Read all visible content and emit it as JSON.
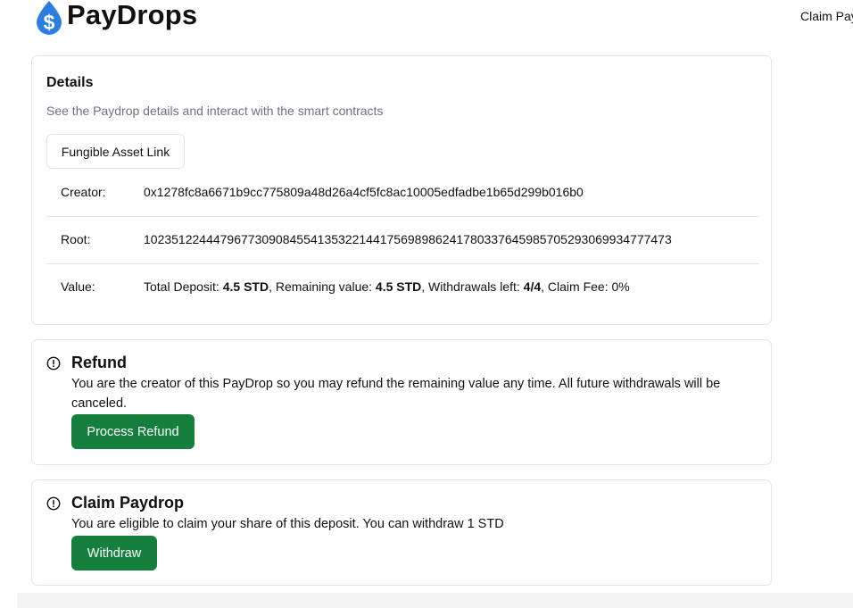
{
  "header": {
    "brand": "PayDrops",
    "logo_icon": "dollar-drop-icon",
    "nav_link": "Claim Pay"
  },
  "details": {
    "title": "Details",
    "description": "See the Paydrop details and interact with the smart contracts",
    "asset_button": "Fungible Asset Link",
    "creator_label": "Creator:",
    "creator_value": "0x1278fc8a6671b9cc775809a48d26a4cf5fc8ac10005edfadbe1b65d299b016b0",
    "root_label": "Root:",
    "root_value": "10235122444796773090845541353221441756989862417803376459857052930699347​77473",
    "value_label": "Value:",
    "value": {
      "total_label": "Total Deposit: ",
      "total": "4.5 STD",
      "remaining_label": ", Remaining value: ",
      "remaining": "4.5 STD",
      "withdrawals_label": ", Withdrawals left: ",
      "withdrawals": "4/4",
      "fee_text": ", Claim Fee: 0%"
    }
  },
  "refund": {
    "icon": "alert-circle-icon",
    "title": "Refund",
    "text": "You are the creator of this PayDrop so you may refund the remaining value any time. All future withdrawals will be canceled.",
    "button": "Process Refund"
  },
  "claim": {
    "icon": "alert-circle-icon",
    "title": "Claim Paydrop",
    "text": "You are eligible to claim your share of this deposit. You can withdraw 1 STD",
    "button": "Withdraw"
  },
  "colors": {
    "primary_green": "#15803d",
    "logo_blue": "#2b7de0",
    "border": "#e4e4e7",
    "muted_text": "#6b7280"
  }
}
